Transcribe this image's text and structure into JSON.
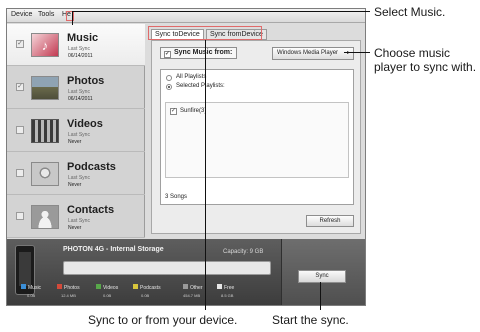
{
  "menubar": {
    "items": [
      "Device",
      "Tools",
      "He"
    ]
  },
  "sidebar": {
    "items": [
      {
        "title": "Music",
        "status_label": "Last Sync",
        "status_value": "06/14/2011",
        "checked": true,
        "active": true
      },
      {
        "title": "Photos",
        "status_label": "Last Sync",
        "status_value": "06/14/2011",
        "checked": true,
        "active": false
      },
      {
        "title": "Videos",
        "status_label": "Last Sync",
        "status_value": "Never",
        "checked": false,
        "active": false
      },
      {
        "title": "Podcasts",
        "status_label": "Last Sync",
        "status_value": "Never",
        "checked": false,
        "active": false
      },
      {
        "title": "Contacts",
        "status_label": "Last Sync",
        "status_value": "Never",
        "checked": false,
        "active": false
      }
    ]
  },
  "sync_panel": {
    "tabs": [
      {
        "label": "Sync toDevice",
        "active": true
      },
      {
        "label": "Sync fromDevice",
        "active": false
      }
    ],
    "sync_from_label": "Sync Music from:",
    "player_select": "Windows Media Player",
    "options": [
      {
        "label": "All Playlists",
        "selected": false
      },
      {
        "label": "Selected Playlists:",
        "selected": true
      }
    ],
    "playlists": [
      {
        "name": "Sunfire(3)",
        "checked": true
      }
    ],
    "song_count": "3 Songs",
    "refresh_label": "Refresh"
  },
  "storage": {
    "device_name": "PHOTON 4G - Internal Storage",
    "capacity": "Capacity: 9 GB",
    "categories": [
      {
        "name": "Music",
        "size": "0.0B",
        "color": "#3b8ed6"
      },
      {
        "name": "Photos",
        "size": "12.4 MB",
        "color": "#d44a3a"
      },
      {
        "name": "Videos",
        "size": "0.0B",
        "color": "#58a84a"
      },
      {
        "name": "Podcasts",
        "size": "0.0B",
        "color": "#d8c63c"
      },
      {
        "name": "Other",
        "size": "454.7 MB",
        "color": "#9a9a9a"
      },
      {
        "name": "Free",
        "size": "8.5 GB",
        "color": "#e6e6e6"
      }
    ],
    "sync_label": "Sync"
  },
  "annotations": {
    "select_music": "Select Music.",
    "choose_player": "Choose music player to sync with.",
    "sync_direction": "Sync to or from your device.",
    "start_sync": "Start the sync."
  }
}
